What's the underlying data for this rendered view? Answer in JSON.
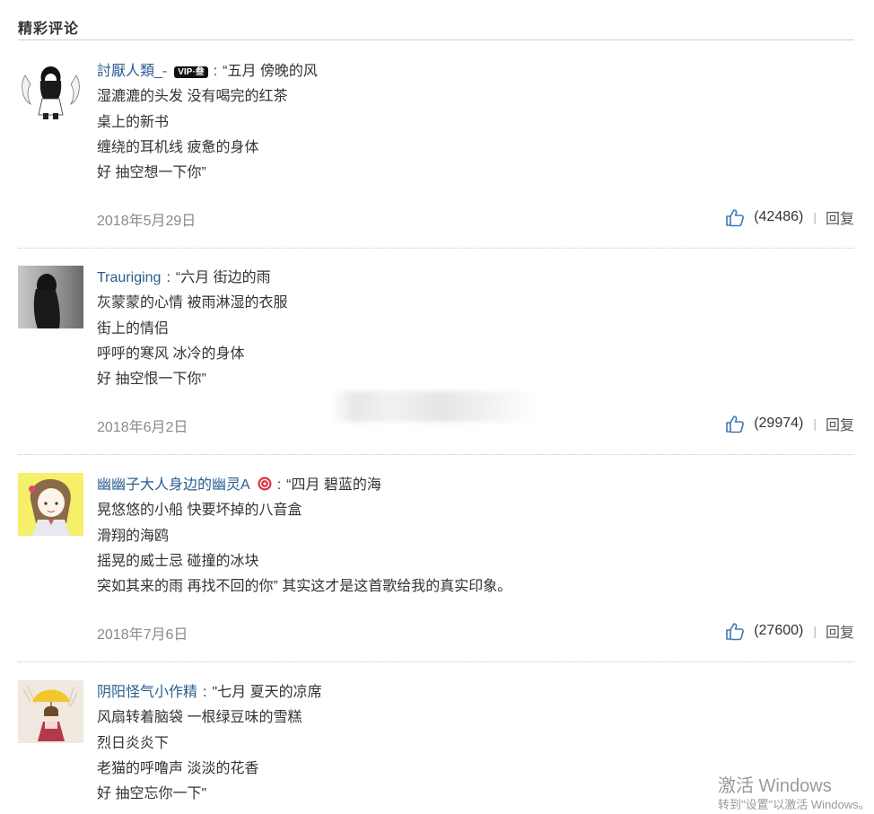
{
  "section": {
    "title": "精彩评论"
  },
  "colors": {
    "username": "#2b5d91",
    "text": "#333333",
    "date": "#8a8a8a",
    "like_icon": "#3d78b8"
  },
  "comments": [
    {
      "username": "討厭人類_-",
      "badge": "VIP·叁",
      "lines": [
        "“五月 傍晚的风",
        "湿漉漉的头发 没有喝完的红茶",
        "桌上的新书",
        "缠绕的耳机线 疲惫的身体",
        "好 抽空想一下你”"
      ],
      "date": "2018年5月29日",
      "likes": "(42486)",
      "reply": "回复"
    },
    {
      "username": "Trauriging",
      "lines": [
        "“六月 街边的雨",
        "灰蒙蒙的心情 被雨淋湿的衣服",
        "街上的情侣",
        "呼呼的寒风 冰冷的身体",
        "好 抽空恨一下你”"
      ],
      "date": "2018年6月2日",
      "likes": "(29974)",
      "reply": "回复"
    },
    {
      "username": "幽幽子大人身边的幽灵A",
      "lines": [
        "“四月 碧蓝的海",
        "晃悠悠的小船 快要坏掉的八音盒",
        "滑翔的海鸥",
        "摇晃的威士忌 碰撞的冰块",
        "突如其来的雨 再找不回的你” 其实这才是这首歌给我的真实印象。"
      ],
      "date": "2018年7月6日",
      "likes": "(27600)",
      "reply": "回复"
    },
    {
      "username": "阴阳怪气小作精",
      "lines": [
        "\"七月 夏天的凉席",
        "风扇转着脑袋 一根绿豆味的雪糕",
        "烈日炎炎下",
        "老猫的呼噜声 淡淡的花香",
        "好 抽空忘你一下\""
      ]
    }
  ],
  "watermark": {
    "title": "激活 Windows",
    "subtitle": "转到\"设置\"以激活 Windows。"
  }
}
